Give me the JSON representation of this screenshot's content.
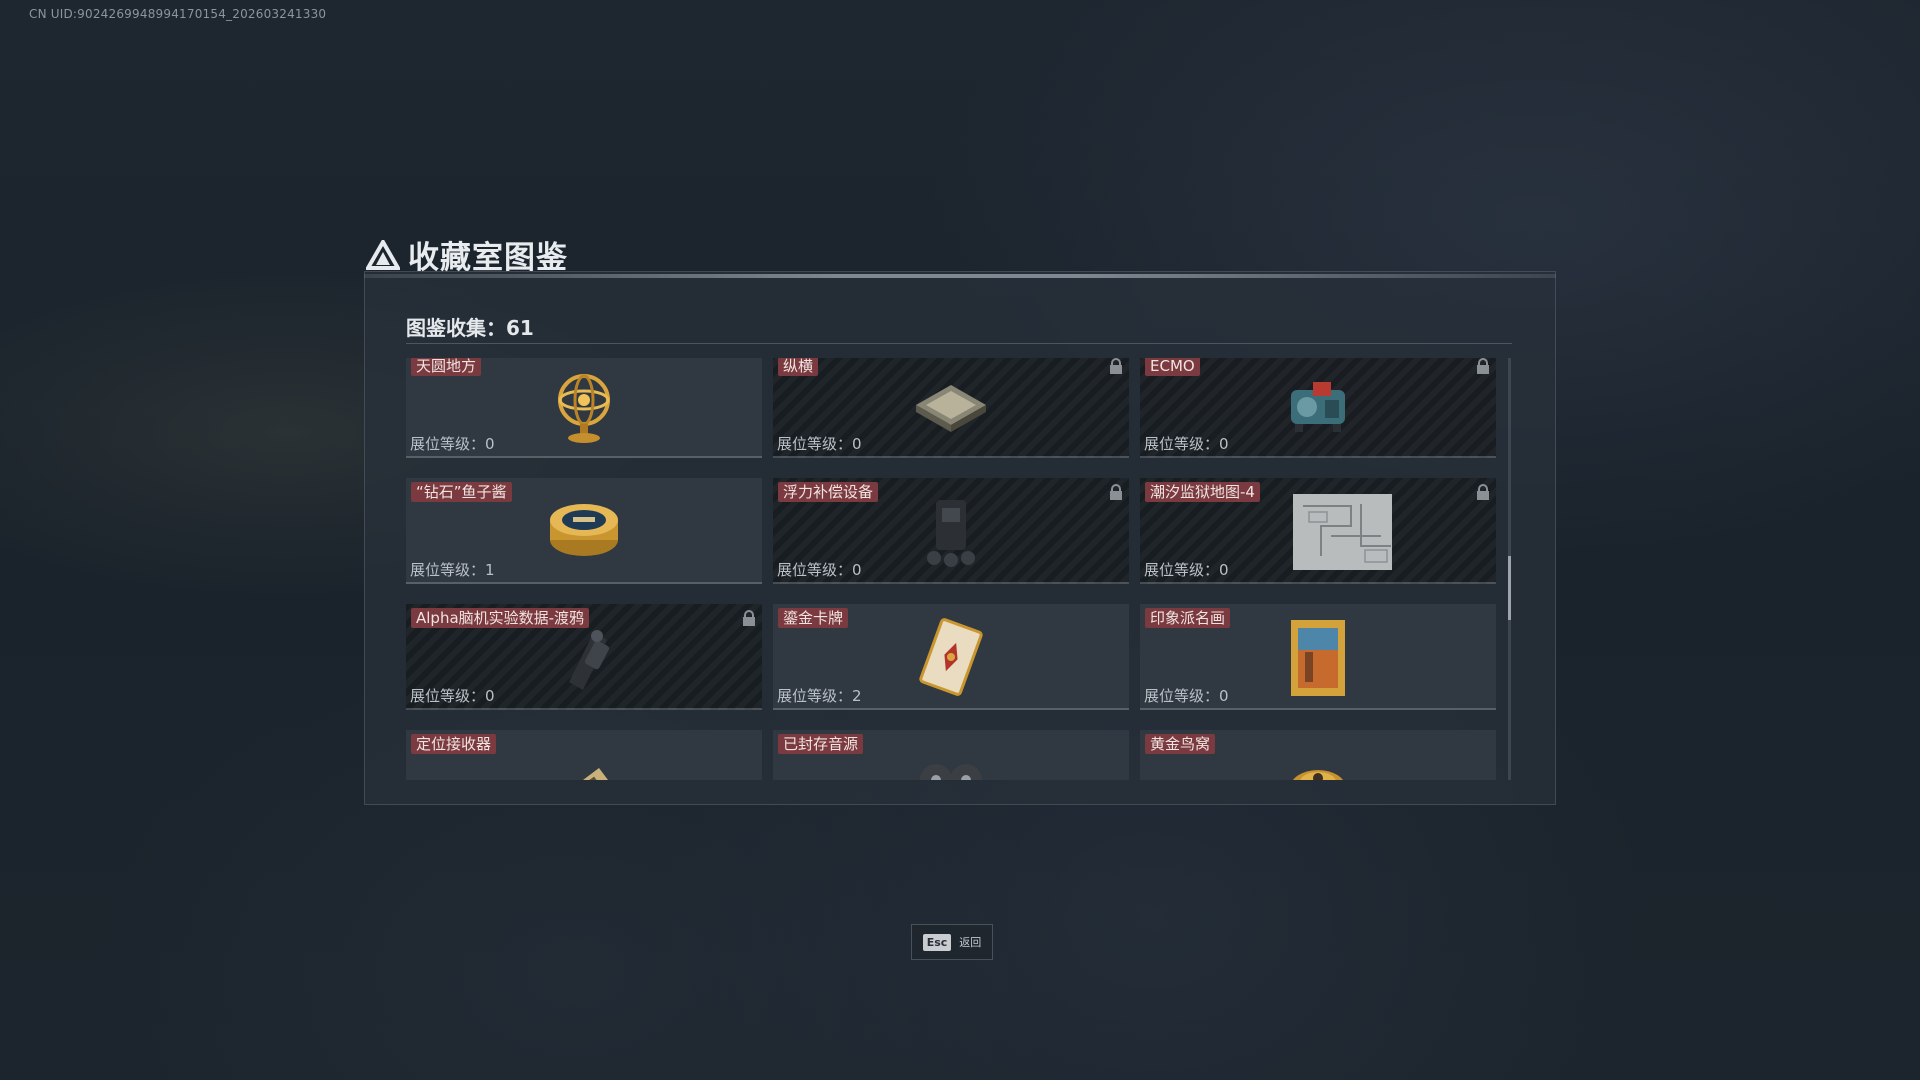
{
  "uid_text": "CN UID:9024269948994170154_202603241330",
  "title": "收藏室图鉴",
  "collection": {
    "label": "图鉴收集：61"
  },
  "items": [
    {
      "name": "天圆地方",
      "level": "展位等级：0",
      "locked": false,
      "icon": "armillary-sphere-icon"
    },
    {
      "name": "纵横",
      "level": "展位等级：0",
      "locked": true,
      "icon": "chessboard-icon"
    },
    {
      "name": "ECMO",
      "level": "展位等级：0",
      "locked": true,
      "icon": "ecmo-machine-icon"
    },
    {
      "name": "“钻石”鱼子酱",
      "level": "展位等级：1",
      "locked": false,
      "icon": "caviar-tin-icon"
    },
    {
      "name": "浮力补偿设备",
      "level": "展位等级：0",
      "locked": true,
      "icon": "buoyancy-device-icon"
    },
    {
      "name": "潮汐监狱地图-4",
      "level": "展位等级：0",
      "locked": true,
      "icon": "prison-map-icon"
    },
    {
      "name": "Alpha脑机实验数据-渡鸦",
      "level": "展位等级：0",
      "locked": true,
      "icon": "data-device-icon"
    },
    {
      "name": "鎏金卡牌",
      "level": "展位等级：2",
      "locked": false,
      "icon": "gilded-card-icon"
    },
    {
      "name": "印象派名画",
      "level": "展位等级：0",
      "locked": false,
      "icon": "framed-painting-icon"
    },
    {
      "name": "定位接收器",
      "level": "",
      "locked": false,
      "icon": "locator-receiver-icon"
    },
    {
      "name": "已封存音源",
      "level": "",
      "locked": false,
      "icon": "sealed-audio-reel-icon"
    },
    {
      "name": "黄金鸟窝",
      "level": "",
      "locked": false,
      "icon": "golden-nest-icon"
    }
  ],
  "footer": {
    "key": "Esc",
    "label": "返回"
  },
  "colors": {
    "tag": "#7a3a3f",
    "gold": "#d9a53c",
    "panel": "#28303a"
  }
}
